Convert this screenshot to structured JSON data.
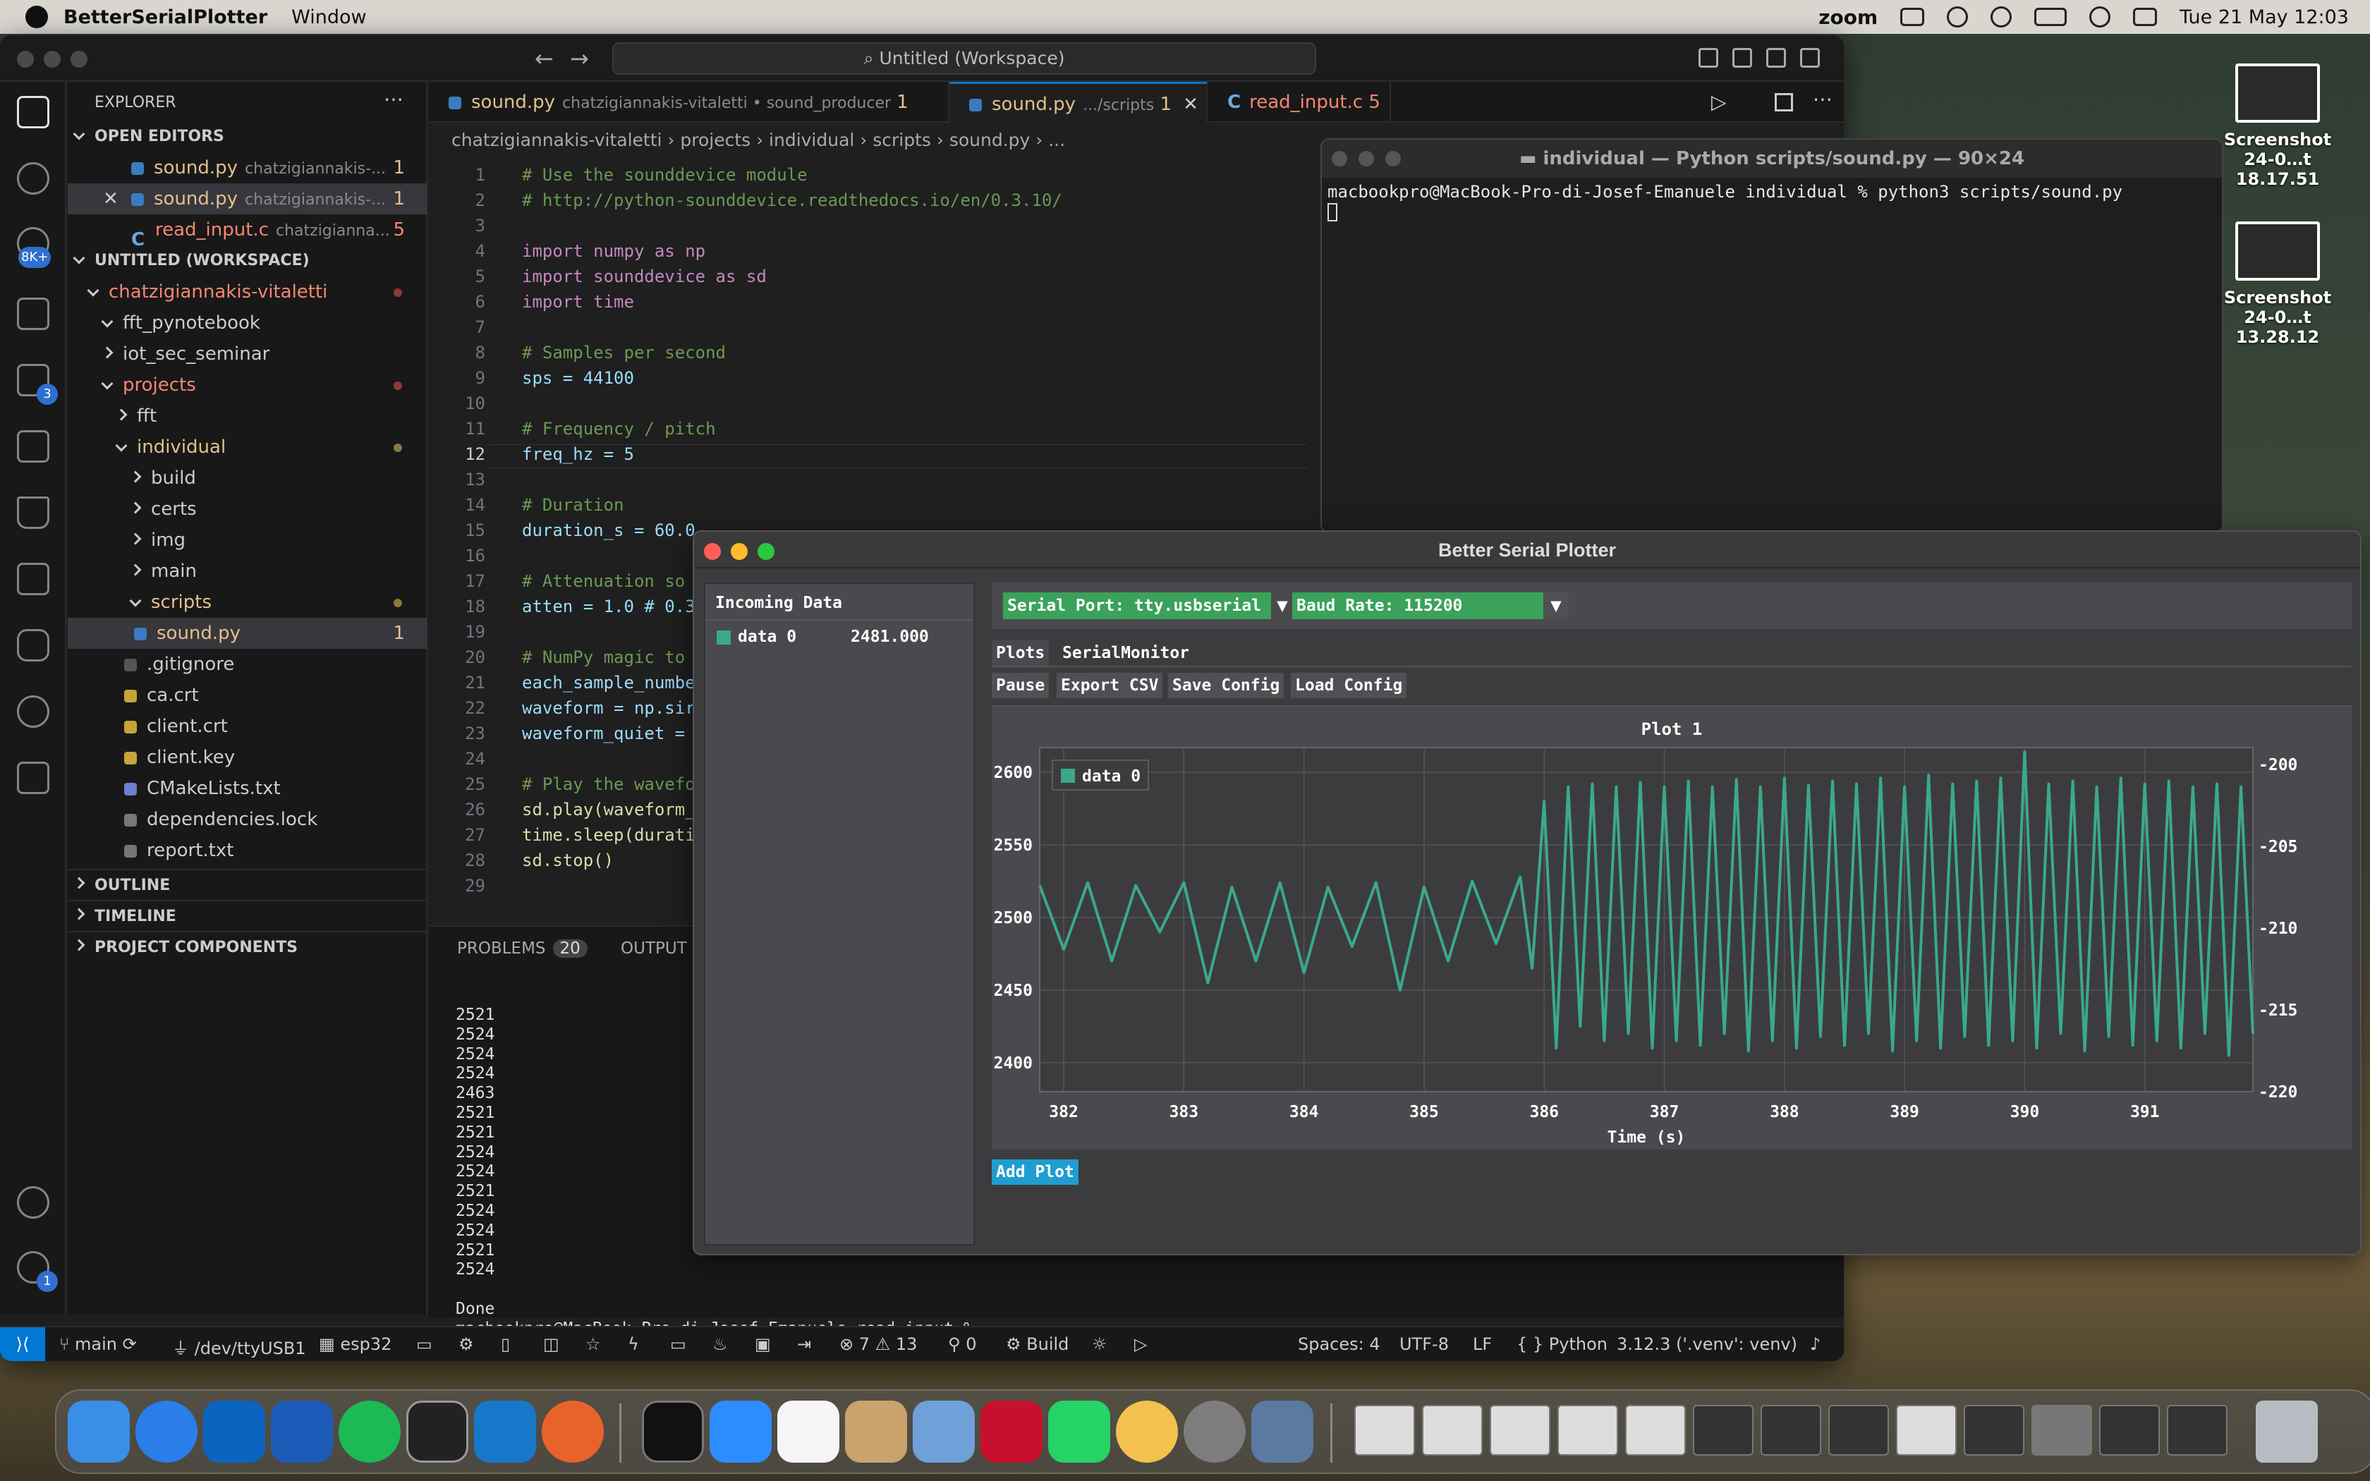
{
  "menubar": {
    "app": "BetterSerialPlotter",
    "menu": "Window",
    "zoom": "zoom",
    "datetime": "Tue 21 May  12:03"
  },
  "desktop": {
    "items": [
      {
        "label1": "Screenshot",
        "label2": "24-0…t 18.17.51"
      },
      {
        "label1": "Screenshot",
        "label2": "24-0…t 13.28.12"
      }
    ]
  },
  "vscode": {
    "command_center": "Untitled (Workspace)",
    "activity_badges": {
      "scm": "8K+",
      "extensions": "3",
      "settings": "1"
    },
    "sidebar": {
      "title": "EXPLORER",
      "open_editors_header": "OPEN EDITORS",
      "open_editors": [
        {
          "name": "sound.py",
          "path": "chatzigiannakis-...",
          "count": "1"
        },
        {
          "name": "sound.py",
          "path": "chatzigiannakis-...",
          "count": "1"
        },
        {
          "name": "read_input.c",
          "path": "chatzigianna...",
          "count": "5"
        }
      ],
      "workspace_header": "UNTITLED (WORKSPACE)",
      "tree": [
        {
          "label": "chatzigiannakis-vitaletti"
        },
        {
          "label": "fft_pynotebook"
        },
        {
          "label": "iot_sec_seminar"
        },
        {
          "label": "projects"
        },
        {
          "label": "fft"
        },
        {
          "label": "individual"
        },
        {
          "label": "build"
        },
        {
          "label": "certs"
        },
        {
          "label": "img"
        },
        {
          "label": "main"
        },
        {
          "label": "scripts"
        },
        {
          "label": "sound.py",
          "count": "1"
        },
        {
          "label": ".gitignore"
        },
        {
          "label": "ca.crt"
        },
        {
          "label": "client.crt"
        },
        {
          "label": "client.key"
        },
        {
          "label": "CMakeLists.txt"
        },
        {
          "label": "dependencies.lock"
        },
        {
          "label": "report.txt"
        }
      ],
      "outline": "OUTLINE",
      "timeline": "TIMELINE",
      "components": "PROJECT COMPONENTS"
    },
    "tabs": [
      {
        "name": "sound.py",
        "desc": "chatzigiannakis-vitaletti • sound_producer",
        "count": "1"
      },
      {
        "name": "sound.py",
        "desc": ".../scripts",
        "count": "1"
      },
      {
        "name": "read_input.c",
        "count": "5"
      }
    ],
    "breadcrumb": "chatzigiannakis-vitaletti  ›  projects  ›  individual  ›  scripts  ›  sound.py  ›  ...",
    "code": [
      {
        "n": "1",
        "t": "# Use the sounddevice module"
      },
      {
        "n": "2",
        "t": "# http://python-sounddevice.readthedocs.io/en/0.3.10/"
      },
      {
        "n": "3",
        "t": ""
      },
      {
        "n": "4",
        "t": "import numpy as np"
      },
      {
        "n": "5",
        "t": "import sounddevice as sd"
      },
      {
        "n": "6",
        "t": "import time"
      },
      {
        "n": "7",
        "t": ""
      },
      {
        "n": "8",
        "t": "# Samples per second"
      },
      {
        "n": "9",
        "t": "sps = 44100"
      },
      {
        "n": "10",
        "t": ""
      },
      {
        "n": "11",
        "t": "# Frequency / pitch"
      },
      {
        "n": "12",
        "t": "freq_hz = 5"
      },
      {
        "n": "13",
        "t": ""
      },
      {
        "n": "14",
        "t": "# Duration"
      },
      {
        "n": "15",
        "t": "duration_s = 60.0"
      },
      {
        "n": "16",
        "t": ""
      },
      {
        "n": "17",
        "t": "# Attenuation so"
      },
      {
        "n": "18",
        "t": "atten = 1.0 # 0.3"
      },
      {
        "n": "19",
        "t": ""
      },
      {
        "n": "20",
        "t": "# NumPy magic to"
      },
      {
        "n": "21",
        "t": "each_sample_numbe"
      },
      {
        "n": "22",
        "t": "waveform = np.sir"
      },
      {
        "n": "23",
        "t": "waveform_quiet = "
      },
      {
        "n": "24",
        "t": ""
      },
      {
        "n": "25",
        "t": "# Play the wavefo"
      },
      {
        "n": "26",
        "t": "sd.play(waveform_"
      },
      {
        "n": "27",
        "t": "time.sleep(durati"
      },
      {
        "n": "28",
        "t": "sd.stop()"
      },
      {
        "n": "29",
        "t": ""
      }
    ],
    "panel": {
      "problems": "PROBLEMS",
      "problems_count": "20",
      "output": "OUTPUT",
      "lines": [
        "2521",
        "2524",
        "2524",
        "2524",
        "2463",
        "2521",
        "2521",
        "2524",
        "2524",
        "2521",
        "2524",
        "2524",
        "2521",
        "2524",
        "",
        "Done",
        "macbookpro@MacBook-Pro-di-Josef-Emanuele read_input % "
      ]
    },
    "status": {
      "branch": "main",
      "port": "/dev/ttyUSB1",
      "target": "esp32",
      "errors": "7",
      "warnings": "13",
      "ports": "0",
      "build": "Build",
      "spaces": "Spaces: 4",
      "encoding": "UTF-8",
      "eol": "LF",
      "lang": "Python",
      "interp": "3.12.3 ('.venv': venv)"
    }
  },
  "terminal": {
    "title": "individual — Python scripts/sound.py — 90×24",
    "line": "macbookpro@MacBook-Pro-di-Josef-Emanuele individual % python3 scripts/sound.py"
  },
  "plotter": {
    "title": "Better Serial Plotter",
    "incoming_title": "Incoming Data",
    "data_name": "data 0",
    "data_value": "2481.000",
    "serial_port": "Serial Port: tty.usbserial",
    "baud_rate": "Baud Rate: 115200",
    "tab_plots": "Plots",
    "tab_monitor": "SerialMonitor",
    "btn_pause": "Pause",
    "btn_export": "Export CSV",
    "btn_save": "Save Config",
    "btn_load": "Load Config",
    "add_plot": "Add Plot",
    "series_color": "#3aa98a"
  },
  "chart_data": {
    "type": "line",
    "title": "Plot 1",
    "xlabel": "Time (s)",
    "xlim": [
      381.8,
      391.9
    ],
    "ylim": [
      2380,
      2617
    ],
    "x_ticks": [
      "382",
      "383",
      "384",
      "385",
      "386",
      "387",
      "388",
      "389",
      "390",
      "391"
    ],
    "y_ticks": [
      "2600",
      "2550",
      "2500",
      "2450",
      "2400"
    ],
    "y2_ticks": [
      "-200",
      "-205",
      "-210",
      "-215",
      "-220"
    ],
    "legend": "top-left",
    "grid": true,
    "series": [
      {
        "name": "data 0",
        "x": [
          381.8,
          382.0,
          382.2,
          382.4,
          382.6,
          382.8,
          383.0,
          383.2,
          383.4,
          383.6,
          383.8,
          384.0,
          384.2,
          384.4,
          384.6,
          384.8,
          385.0,
          385.2,
          385.4,
          385.6,
          385.8,
          385.9,
          386.0,
          386.1,
          386.2,
          386.3,
          386.4,
          386.5,
          386.6,
          386.7,
          386.8,
          386.9,
          387.0,
          387.1,
          387.2,
          387.3,
          387.4,
          387.5,
          387.6,
          387.7,
          387.8,
          387.9,
          388.0,
          388.1,
          388.2,
          388.3,
          388.4,
          388.5,
          388.6,
          388.7,
          388.8,
          388.9,
          389.0,
          389.1,
          389.2,
          389.3,
          389.4,
          389.5,
          389.6,
          389.7,
          389.8,
          389.9,
          390.0,
          390.1,
          390.2,
          390.3,
          390.4,
          390.5,
          390.6,
          390.7,
          390.8,
          390.9,
          391.0,
          391.1,
          391.2,
          391.3,
          391.4,
          391.5,
          391.6,
          391.7,
          391.8,
          391.9
        ],
        "y": [
          2522,
          2478,
          2524,
          2470,
          2522,
          2490,
          2524,
          2455,
          2521,
          2470,
          2524,
          2462,
          2521,
          2480,
          2524,
          2450,
          2521,
          2470,
          2525,
          2482,
          2528,
          2465,
          2580,
          2410,
          2590,
          2425,
          2592,
          2415,
          2590,
          2420,
          2593,
          2410,
          2590,
          2415,
          2594,
          2412,
          2590,
          2420,
          2595,
          2408,
          2590,
          2415,
          2596,
          2410,
          2591,
          2418,
          2594,
          2412,
          2592,
          2420,
          2596,
          2408,
          2590,
          2415,
          2598,
          2410,
          2592,
          2418,
          2594,
          2412,
          2596,
          2415,
          2614,
          2410,
          2592,
          2420,
          2594,
          2408,
          2590,
          2418,
          2596,
          2412,
          2592,
          2415,
          2594,
          2410,
          2590,
          2420,
          2592,
          2405,
          2590,
          2420
        ]
      }
    ]
  }
}
